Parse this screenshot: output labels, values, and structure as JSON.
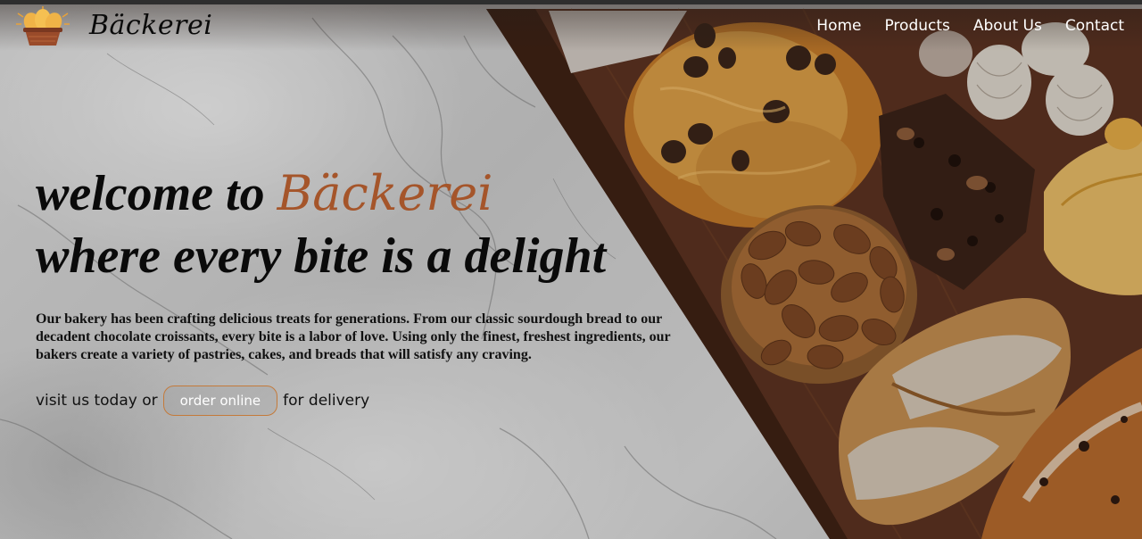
{
  "brand": {
    "name": "Bäckerei",
    "logo_icon": "bread-basket-icon"
  },
  "nav": {
    "items": [
      {
        "label": "Home"
      },
      {
        "label": "Products"
      },
      {
        "label": "About Us"
      },
      {
        "label": "Contact"
      }
    ]
  },
  "hero": {
    "headline_prefix": "welcome to ",
    "headline_brand": "Bäckerei",
    "headline_line2": "where every bite is a delight",
    "description": "Our bakery has been crafting delicious treats for generations. From our classic sourdough bread to our decadent chocolate croissants, every bite is a labor of love. Using only the finest, freshest ingredients, our bakers create a variety of pastries, cakes, and breads that will satisfy any craving.",
    "cta_before": "visit us today or",
    "cta_button": "order online",
    "cta_after": "for delivery"
  },
  "colors": {
    "accent": "#a5552a",
    "button_border": "#c47a3a",
    "nav_text": "#ffffff",
    "text": "#0a0a0a"
  }
}
